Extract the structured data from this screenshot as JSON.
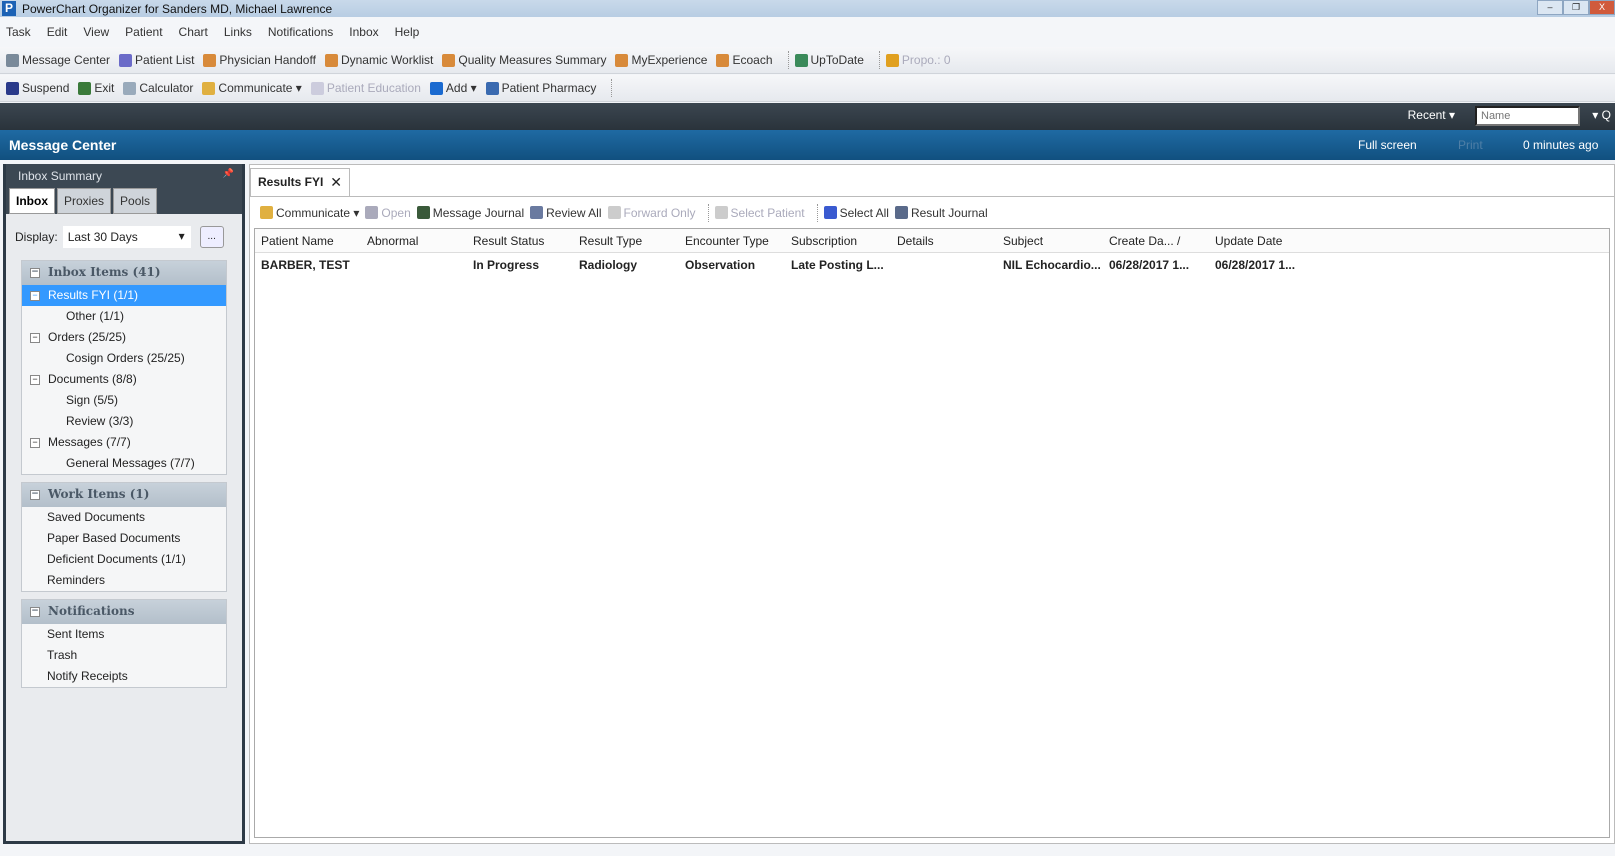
{
  "window": {
    "title": "PowerChart Organizer for Sanders MD, Michael Lawrence",
    "logo": "P",
    "minimize": "–",
    "restore": "❐",
    "close": "X"
  },
  "menu": [
    "Task",
    "Edit",
    "View",
    "Patient",
    "Chart",
    "Links",
    "Notifications",
    "Inbox",
    "Help"
  ],
  "toolbar1": [
    {
      "label": "Message Center",
      "icon": "envelope-icon",
      "color": "#7a8a9a"
    },
    {
      "label": "Patient List",
      "icon": "person-icon",
      "color": "#6b6bc8"
    },
    {
      "label": "Physician Handoff",
      "icon": "chart-icon",
      "color": "#d88a3a"
    },
    {
      "label": "Dynamic Worklist",
      "icon": "chart-icon",
      "color": "#d88a3a"
    },
    {
      "label": "Quality Measures Summary",
      "icon": "chart-icon",
      "color": "#d88a3a"
    },
    {
      "label": "MyExperience",
      "icon": "chart-icon",
      "color": "#d88a3a"
    },
    {
      "label": "Ecoach",
      "icon": "chart-icon",
      "color": "#d88a3a"
    },
    {
      "label": "UpToDate",
      "icon": "globe-search-icon",
      "color": "#3a8a5a"
    },
    {
      "label": "Propo.: 0",
      "icon": "coins-icon",
      "color": "#e0a020",
      "disabled": true
    }
  ],
  "toolbar2": [
    {
      "label": "Suspend",
      "icon": "suspend-icon",
      "color": "#2a3a8a"
    },
    {
      "label": "Exit",
      "icon": "exit-icon",
      "color": "#3a7a3a"
    },
    {
      "label": "Calculator",
      "icon": "calculator-icon",
      "color": "#9ab"
    },
    {
      "label": "Communicate ▾",
      "icon": "communicate-icon",
      "color": "#e0b040"
    },
    {
      "label": "Patient Education",
      "icon": "document-icon",
      "color": "#ccd",
      "disabled": true
    },
    {
      "label": "Add ▾",
      "icon": "plus-icon",
      "color": "#1a6ad0"
    },
    {
      "label": "Patient Pharmacy",
      "icon": "pharmacy-icon",
      "color": "#3a6ab0"
    }
  ],
  "topbar": {
    "recent": "Recent ▾",
    "name_placeholder": "Name",
    "search": "▾ Q"
  },
  "header": {
    "title": "Message Center",
    "full_screen": "Full screen",
    "print": "Print",
    "refreshed": "0 minutes ago"
  },
  "inbox": {
    "title": "Inbox Summary",
    "pin": "📌",
    "tabs": [
      "Inbox",
      "Proxies",
      "Pools"
    ],
    "display_label": "Display:",
    "display_value": "Last 30 Days",
    "more": "...",
    "groups": [
      {
        "title": "Inbox Items (41)",
        "items": [
          {
            "label": "Results FYI (1/1)",
            "level": 0,
            "selected": true
          },
          {
            "label": "Other (1/1)",
            "level": 1
          },
          {
            "label": "Orders (25/25)",
            "level": 0
          },
          {
            "label": "Cosign Orders (25/25)",
            "level": 1
          },
          {
            "label": "Documents (8/8)",
            "level": 0
          },
          {
            "label": "Sign (5/5)",
            "level": 1
          },
          {
            "label": "Review (3/3)",
            "level": 1
          },
          {
            "label": "Messages (7/7)",
            "level": 0
          },
          {
            "label": "General Messages (7/7)",
            "level": 1
          }
        ]
      },
      {
        "title": "Work Items (1)",
        "items": [
          {
            "label": "Saved Documents"
          },
          {
            "label": "Paper Based Documents"
          },
          {
            "label": "Deficient Documents (1/1)"
          },
          {
            "label": "Reminders"
          }
        ]
      },
      {
        "title": "Notifications",
        "items": [
          {
            "label": "Sent Items"
          },
          {
            "label": "Trash"
          },
          {
            "label": "Notify Receipts"
          }
        ]
      }
    ]
  },
  "main": {
    "tab": "Results FYI",
    "tab_close": "✕",
    "actions": [
      {
        "label": "Communicate ▾",
        "color": "#e0b040"
      },
      {
        "label": "Open",
        "color": "#aab",
        "disabled": true
      },
      {
        "label": "Message Journal",
        "color": "#3a5a3a"
      },
      {
        "label": "Review All",
        "color": "#6a7aa0"
      },
      {
        "label": "Forward Only",
        "color": "#ccc",
        "disabled": true
      },
      {
        "label": "Select Patient",
        "color": "#ccc",
        "disabled": true
      },
      {
        "label": "Select All",
        "color": "#3a5ad0"
      },
      {
        "label": "Result Journal",
        "color": "#5a6a8a"
      }
    ],
    "columns": [
      "Patient Name",
      "Abnormal",
      "Result Status",
      "Result Type",
      "Encounter Type",
      "Subscription",
      "Details",
      "Subject",
      "Create Da... /",
      "Update Date"
    ],
    "rows": [
      [
        "BARBER, TEST",
        "",
        "In Progress",
        "Radiology",
        "Observation",
        "Late Posting L...",
        "",
        "NIL Echocardio...",
        "06/28/2017 1...",
        "06/28/2017 1..."
      ]
    ]
  }
}
